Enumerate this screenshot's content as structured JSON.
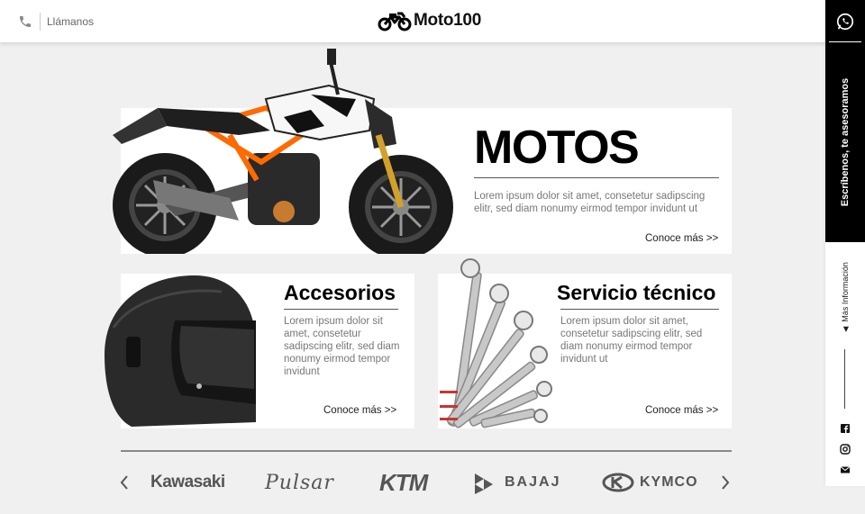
{
  "header": {
    "call_label": "Llámanos",
    "brand_name": "Moto100"
  },
  "sidebar": {
    "vertical_text": "Escríbenos, te asesoramos",
    "more_info": "Más Información"
  },
  "cards": {
    "motos": {
      "title": "MOTOS",
      "description": "Lorem ipsum dolor sit amet, consetetur sadipscing elitr, sed diam nonumy eirmod tempor invidunt ut",
      "link": "Conoce más >>"
    },
    "accesorios": {
      "title": "Accesorios",
      "description": "Lorem ipsum dolor sit amet, consetetur sadipscing elitr, sed diam nonumy eirmod tempor invidunt",
      "link": "Conoce más >>"
    },
    "servicio": {
      "title": "Servicio técnico",
      "description": "Lorem ipsum dolor sit amet, consetetur sadipscing elitr, sed diam nonumy eirmod tempor invidunt ut",
      "link": "Conoce más >>"
    }
  },
  "brands": [
    "Kawasaki",
    "Pulsar",
    "KTM",
    "BAJAJ",
    "KYMCO"
  ],
  "icons": {
    "phone": "phone-icon",
    "whatsapp": "whatsapp-icon",
    "facebook": "facebook-icon",
    "instagram": "instagram-icon",
    "email": "email-icon",
    "prev": "chevron-left-icon",
    "next": "chevron-right-icon"
  },
  "colors": {
    "accent": "#000000",
    "background": "#f0f0f0",
    "text_muted": "#777777"
  }
}
